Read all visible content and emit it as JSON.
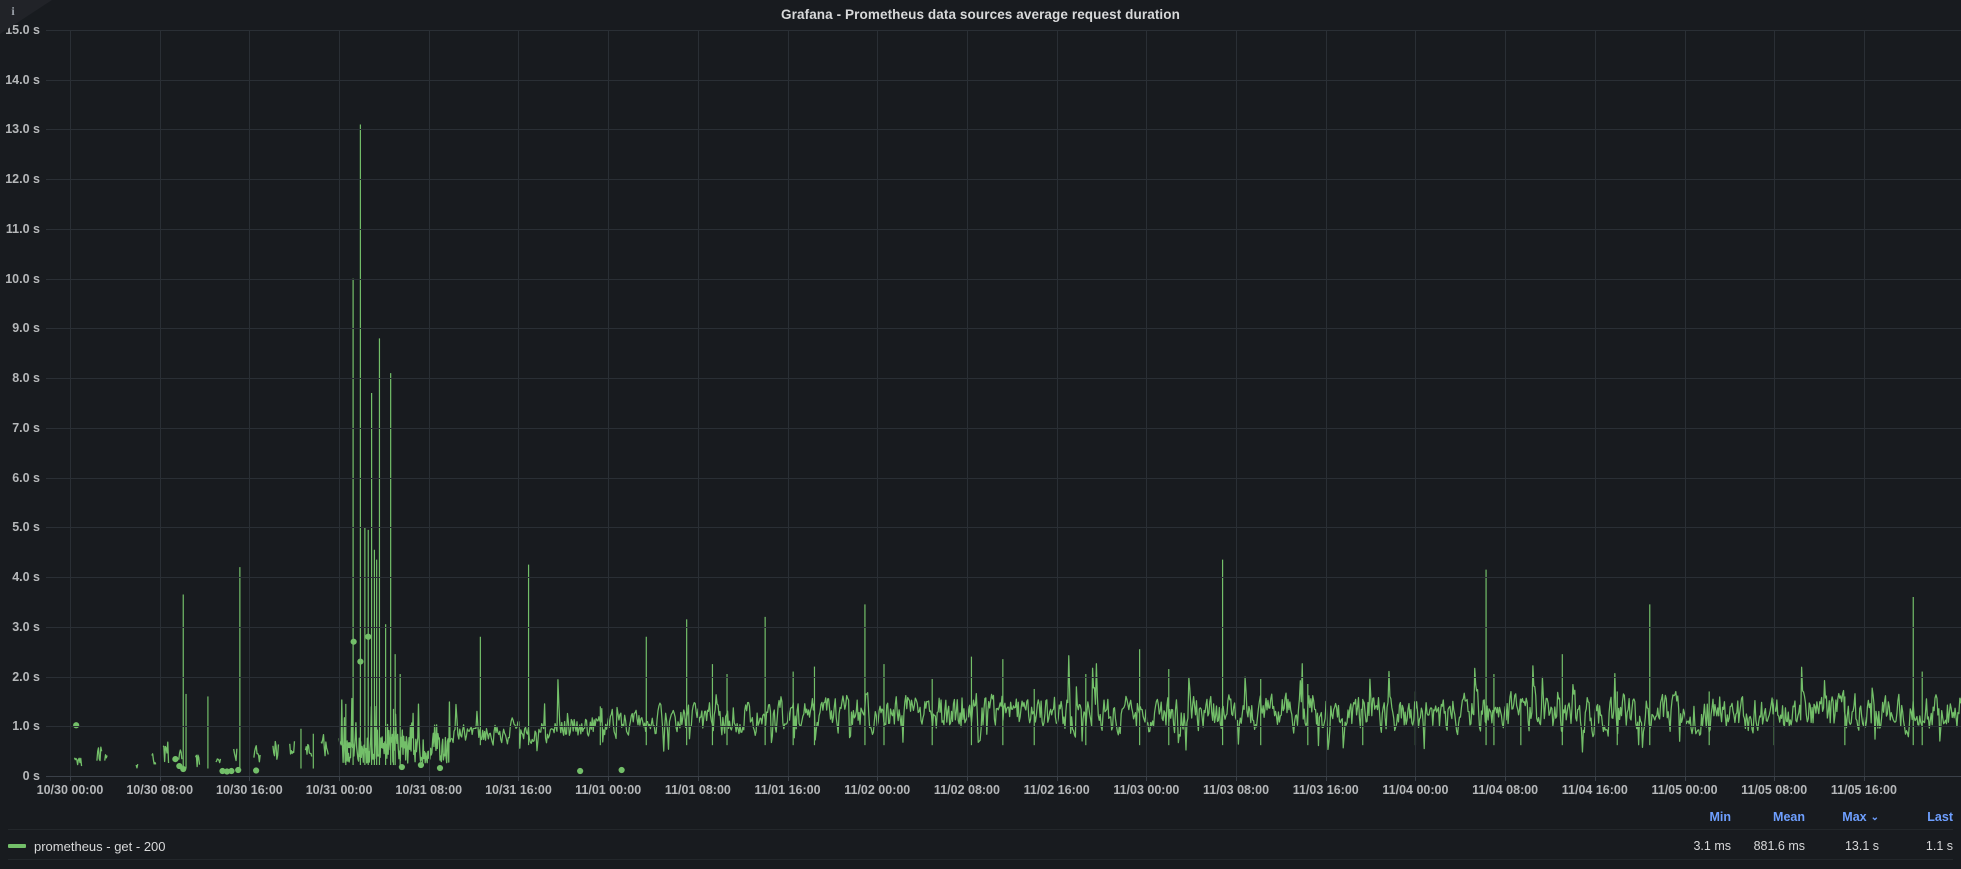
{
  "panel": {
    "title": "Grafana - Prometheus data sources average request duration",
    "info_icon": "i",
    "background": "#181b1f",
    "grid_color": "#2a2f35",
    "series_color": "#73bf69"
  },
  "legend": {
    "stat_headers": [
      "Min",
      "Mean",
      "Max",
      "Last"
    ],
    "sorted_by": "Max",
    "sort_caret": "⌄",
    "series_name": "prometheus - get - 200",
    "stat_values": [
      "3.1 ms",
      "881.6 ms",
      "13.1 s",
      "1.1 s"
    ],
    "swatch_color": "#73bf69"
  },
  "chart_data": {
    "type": "line",
    "title": "Grafana - Prometheus data sources average request duration",
    "xlabel": "",
    "ylabel": "",
    "grid": true,
    "legend_position": "bottom",
    "ylim": [
      0,
      15
    ],
    "y_unit": "s",
    "y_ticks": [
      "0 s",
      "1.0 s",
      "2.0 s",
      "3.0 s",
      "4.0 s",
      "5.0 s",
      "6.0 s",
      "7.0 s",
      "8.0 s",
      "9.0 s",
      "10.0 s",
      "11.0 s",
      "12.0 s",
      "13.0 s",
      "14.0 s",
      "15.0 s"
    ],
    "y_tick_values": [
      0,
      1,
      2,
      3,
      4,
      5,
      6,
      7,
      8,
      9,
      10,
      11,
      12,
      13,
      14,
      15
    ],
    "x_ticks": [
      "10/30 00:00",
      "10/30 08:00",
      "10/30 16:00",
      "10/31 00:00",
      "10/31 08:00",
      "10/31 16:00",
      "11/01 00:00",
      "11/01 08:00",
      "11/01 16:00",
      "11/02 00:00",
      "11/02 08:00",
      "11/02 16:00",
      "11/03 00:00",
      "11/03 08:00",
      "11/03 16:00",
      "11/04 00:00",
      "11/04 08:00",
      "11/04 16:00",
      "11/05 00:00",
      "11/05 08:00",
      "11/05 16:00"
    ],
    "x_range_hours": [
      0,
      168
    ],
    "series": [
      {
        "name": "prometheus - get - 200",
        "color": "#73bf69",
        "min": 0.0031,
        "mean": 0.8816,
        "max": 13.1,
        "last": 1.1,
        "min_label": "3.1 ms",
        "mean_label": "881.6 ms",
        "max_label": "13.1 s",
        "last_label": "1.1 s",
        "notable_peaks": [
          {
            "x": "10/31 02:00",
            "y": 13.1
          },
          {
            "x": "10/31 01:30",
            "y": 10.0
          },
          {
            "x": "10/31 05:00",
            "y": 8.8
          },
          {
            "x": "10/31 06:10",
            "y": 8.1
          },
          {
            "x": "10/31 04:10",
            "y": 7.7
          },
          {
            "x": "10/31 03:30",
            "y": 5.0
          },
          {
            "x": "10/31 03:50",
            "y": 5.0
          },
          {
            "x": "10/31 12:40",
            "y": 4.3
          },
          {
            "x": "11/03 10:00",
            "y": 4.35
          },
          {
            "x": "10/30 15:10",
            "y": 4.2
          },
          {
            "x": "11/04 06:00",
            "y": 4.15
          },
          {
            "x": "10/30 10:00",
            "y": 3.65
          },
          {
            "x": "11/04 16:10",
            "y": 3.45
          },
          {
            "x": "11/02 01:00",
            "y": 3.45
          },
          {
            "x": "11/05 17:30",
            "y": 3.6
          },
          {
            "x": "11/01 15:40",
            "y": 3.2
          },
          {
            "x": "11/01 04:20",
            "y": 3.15
          },
          {
            "x": "11/00 22:40",
            "y": 2.8
          },
          {
            "x": "11/04 09:40",
            "y": 2.45
          },
          {
            "x": "11/02 08:40",
            "y": 2.4
          },
          {
            "x": "11/03 04:10",
            "y": 2.6
          }
        ],
        "isolated_points": [
          {
            "x": "10/30 00:30",
            "y": 1.02
          },
          {
            "x": "10/30 09:40",
            "y": 0.34
          },
          {
            "x": "10/30 09:55",
            "y": 0.2
          },
          {
            "x": "10/30 13:55",
            "y": 0.16
          },
          {
            "x": "10/31 00:40",
            "y": 0.62
          },
          {
            "x": "10/31 01:10",
            "y": 2.7
          },
          {
            "x": "10/31 01:50",
            "y": 2.3
          },
          {
            "x": "10/31 02:30",
            "y": 2.8
          },
          {
            "x": "10/31 05:40",
            "y": 0.18
          },
          {
            "x": "10/31 07:10",
            "y": 0.22
          },
          {
            "x": "11/01 00:40",
            "y": 0.09
          }
        ],
        "description": "Sparse low-density samples with isolated dots over 10/30, a dense spike cluster peaking at 13.1 s around 10/31 02:00, then continuously sampled noisy data from 10/31 onward oscillating mostly between 0.4 s and 1.6 s with occasional spikes to 2-4.4 s.",
        "baseline_band": [
          0.4,
          1.6
        ]
      }
    ]
  }
}
